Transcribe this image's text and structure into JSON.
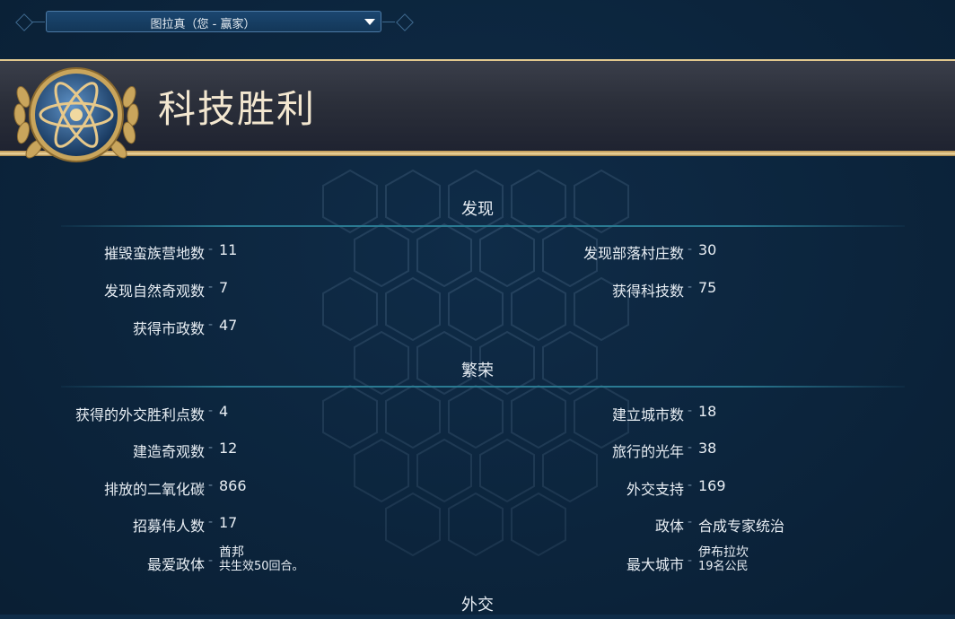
{
  "player_selector": {
    "selected": "图拉真（您 - 赢家）"
  },
  "banner": {
    "title": "科技胜利",
    "emblem_icon": "atom-laurel-icon"
  },
  "sections": {
    "discovery": {
      "title": "发现",
      "stats": {
        "camps_destroyed": {
          "label": "摧毁蛮族营地数",
          "value": "11"
        },
        "villages_found": {
          "label": "发现部落村庄数",
          "value": "30"
        },
        "wonders_found": {
          "label": "发现自然奇观数",
          "value": "7"
        },
        "techs_gained": {
          "label": "获得科技数",
          "value": "75"
        },
        "civics_gained": {
          "label": "获得市政数",
          "value": "47"
        }
      }
    },
    "prosperity": {
      "title": "繁荣",
      "stats": {
        "diplo_points": {
          "label": "获得的外交胜利点数",
          "value": "4"
        },
        "cities_founded": {
          "label": "建立城市数",
          "value": "18"
        },
        "wonders_built": {
          "label": "建造奇观数",
          "value": "12"
        },
        "light_years": {
          "label": "旅行的光年",
          "value": "38"
        },
        "co2": {
          "label": "排放的二氧化碳",
          "value": "866"
        },
        "diplo_favor": {
          "label": "外交支持",
          "value": "169"
        },
        "great_people": {
          "label": "招募伟人数",
          "value": "17"
        },
        "government": {
          "label": "政体",
          "value": "合成专家统治"
        },
        "fav_government": {
          "label": "最爱政体",
          "value": "酋邦",
          "sub": "共生效50回合。"
        },
        "largest_city": {
          "label": "最大城市",
          "value": "伊布拉坎",
          "sub": "19名公民"
        }
      }
    },
    "diplomacy": {
      "title": "外交"
    }
  },
  "colors": {
    "background": "#0f2c48",
    "gold": "#d8b978",
    "divider": "#2a7a92"
  }
}
